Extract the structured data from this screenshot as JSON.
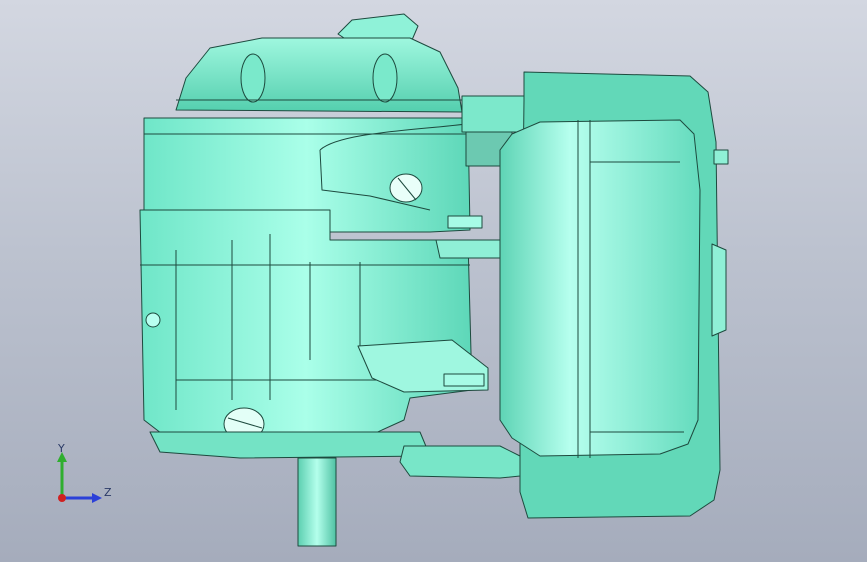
{
  "viewport": {
    "background_top": "#d3d7e1",
    "background_bottom": "#a5acbc",
    "model_color": "#7ff0d4",
    "model_shadow": "#3fb99a",
    "edge_color": "#1d4a3e"
  },
  "triad": {
    "y_label": "Y",
    "z_label": "Z",
    "y_color": "#2fae2f",
    "z_color": "#2b40d8",
    "x_color": "#d02020"
  }
}
